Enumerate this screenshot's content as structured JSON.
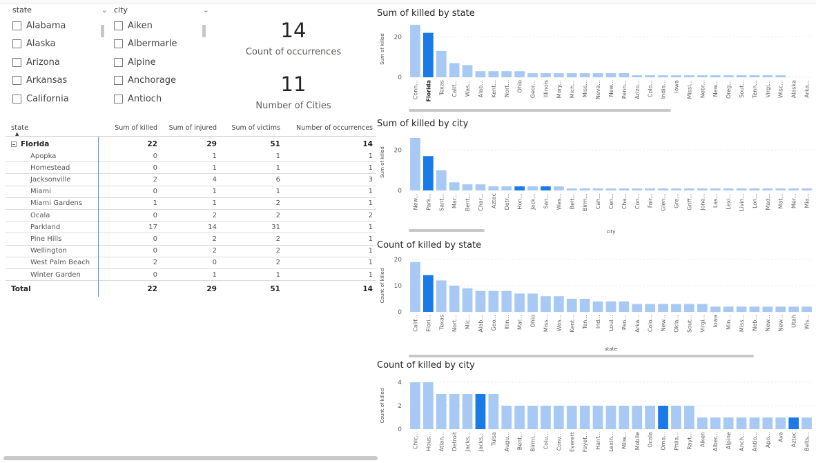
{
  "slicers": {
    "state": {
      "header": "state",
      "items": [
        "Alabama",
        "Alaska",
        "Arizona",
        "Arkansas",
        "California"
      ]
    },
    "city": {
      "header": "city",
      "items": [
        "Aiken",
        "Albermarle",
        "Alpine",
        "Anchorage",
        "Antioch"
      ]
    }
  },
  "cards": {
    "occurrences": {
      "value": "14",
      "label": "Count of occurrences"
    },
    "cities": {
      "value": "11",
      "label": "Number of Cities"
    }
  },
  "matrix": {
    "headers": [
      "state",
      "Sum of killed",
      "Sum of injured",
      "Sum of victims",
      "Number of occurrences"
    ],
    "group": {
      "name": "Florida",
      "killed": "22",
      "injured": "29",
      "victims": "51",
      "occurrences": "14"
    },
    "rows": [
      {
        "city": "Apopka",
        "killed": "0",
        "injured": "1",
        "victims": "1",
        "occurrences": "1"
      },
      {
        "city": "Homestead",
        "killed": "0",
        "injured": "1",
        "victims": "1",
        "occurrences": "1"
      },
      {
        "city": "Jacksonville",
        "killed": "2",
        "injured": "4",
        "victims": "6",
        "occurrences": "3"
      },
      {
        "city": "Miami",
        "killed": "0",
        "injured": "1",
        "victims": "1",
        "occurrences": "1"
      },
      {
        "city": "Miami Gardens",
        "killed": "1",
        "injured": "1",
        "victims": "2",
        "occurrences": "1"
      },
      {
        "city": "Ocala",
        "killed": "0",
        "injured": "2",
        "victims": "2",
        "occurrences": "2"
      },
      {
        "city": "Parkland",
        "killed": "17",
        "injured": "14",
        "victims": "31",
        "occurrences": "1"
      },
      {
        "city": "Pine Hills",
        "killed": "0",
        "injured": "2",
        "victims": "2",
        "occurrences": "1"
      },
      {
        "city": "Wellington",
        "killed": "0",
        "injured": "2",
        "victims": "2",
        "occurrences": "1"
      },
      {
        "city": "West Palm Beach",
        "killed": "2",
        "injured": "0",
        "victims": "2",
        "occurrences": "1"
      },
      {
        "city": "Winter Garden",
        "killed": "0",
        "injured": "1",
        "victims": "1",
        "occurrences": "1"
      }
    ],
    "total": {
      "label": "Total",
      "killed": "22",
      "injured": "29",
      "victims": "51",
      "occurrences": "14"
    }
  },
  "colors": {
    "bar": "#a7c9f3",
    "highlight": "#1a7ae8",
    "grid": "#e8e8e8",
    "text": "#605e5c"
  },
  "chart_data": [
    {
      "type": "bar",
      "title": "Sum of killed by state",
      "ylabel": "Sum of killed",
      "xlabel": "",
      "ylim": [
        0,
        28
      ],
      "yticks": [
        0,
        20
      ],
      "highlight": [
        1
      ],
      "categories": [
        "Conn...",
        "Florida",
        "Texas",
        "Calif...",
        "Was...",
        "Alab...",
        "Kent...",
        "Nort...",
        "Ohio",
        "Geor...",
        "Illinois",
        "Mary...",
        "Mich...",
        "Miss...",
        "Neva...",
        "New...",
        "Penn...",
        "Arizo...",
        "Colo...",
        "India...",
        "Iowa",
        "Missi...",
        "Nebr...",
        "New...",
        "Oreg...",
        "Sout...",
        "Tenn...",
        "Virgi...",
        "Wisc...",
        "Alaska",
        "Arka..."
      ],
      "values": [
        26,
        22,
        13,
        7,
        6,
        3,
        3,
        3,
        3,
        2,
        2,
        2,
        2,
        2,
        2,
        2,
        2,
        1,
        1,
        1,
        1,
        1,
        1,
        1,
        1,
        1,
        1,
        1,
        1,
        0,
        0
      ]
    },
    {
      "type": "bar",
      "title": "Sum of killed by city",
      "ylabel": "Sum of killed",
      "xlabel": "city",
      "ylim": [
        0,
        28
      ],
      "yticks": [
        0,
        20
      ],
      "highlight": [
        1,
        8,
        10,
        31
      ],
      "categories": [
        "New...",
        "Park...",
        "Sant...",
        "Mar...",
        "Bent...",
        "Char...",
        "Aztec",
        "Detr...",
        "Hon...",
        "Jack...",
        "San...",
        "Wes...",
        "Belt...",
        "Birm...",
        "Cah...",
        "Cen...",
        "Cha...",
        "Con...",
        "Fair...",
        "Glen...",
        "Gre...",
        "Griff...",
        "Jone...",
        "Las...",
        "Lexi...",
        "Livin...",
        "Lon...",
        "Mad...",
        "Mat...",
        "Mer...",
        "Mia..."
      ],
      "values": [
        26,
        17,
        10,
        4,
        3,
        3,
        2,
        2,
        2,
        2,
        2,
        2,
        1,
        1,
        1,
        1,
        1,
        1,
        1,
        1,
        1,
        1,
        1,
        1,
        1,
        1,
        1,
        1,
        1,
        1,
        1
      ]
    },
    {
      "type": "bar",
      "title": "Count of killed by state",
      "ylabel": "Count of killed",
      "xlabel": "state",
      "ylim": [
        0,
        20
      ],
      "yticks": [
        0,
        10,
        20
      ],
      "highlight": [
        1
      ],
      "categories": [
        "Calif...",
        "Flori...",
        "Texas",
        "Nort...",
        "Mic...",
        "Alab...",
        "Geo...",
        "Illin...",
        "Mar...",
        "Ohio",
        "Miss...",
        "Was...",
        "Kent...",
        "Ten...",
        "Ind...",
        "Loui...",
        "Pen...",
        "Arka...",
        "Colo...",
        "New...",
        "Okla...",
        "Sout...",
        "Virgi...",
        "Iowa",
        "Min...",
        "Miss...",
        "Neb...",
        "New...",
        "New...",
        "Utah",
        "Wis..."
      ],
      "values": [
        19,
        14,
        12,
        10,
        9,
        8,
        8,
        8,
        7,
        7,
        6,
        6,
        5,
        5,
        4,
        4,
        4,
        3,
        3,
        3,
        3,
        3,
        3,
        2,
        2,
        2,
        2,
        2,
        2,
        2,
        2
      ]
    },
    {
      "type": "bar",
      "title": "Count of killed by city",
      "ylabel": "Count of killed",
      "xlabel": "",
      "ylim": [
        0,
        4
      ],
      "yticks": [
        0,
        2,
        4
      ],
      "highlight": [
        5,
        19,
        29
      ],
      "categories": [
        "Chic...",
        "Hous...",
        "Atlan...",
        "Detroit",
        "Jacks...",
        "Jacks...",
        "Tulsa",
        "Augu...",
        "Bent...",
        "Birmi...",
        "Colu...",
        "Conv...",
        "Everett",
        "Fayet...",
        "Hanf...",
        "Lexin...",
        "Milw...",
        "Mobile",
        "Ocala",
        "Oma...",
        "Phila...",
        "Rayt...",
        "Aiken",
        "Alber...",
        "Alpine",
        "Anch...",
        "Antio...",
        "Apo...",
        "Ava",
        "Aztec",
        "Belts..."
      ],
      "values": [
        4,
        4,
        3,
        3,
        3,
        3,
        3,
        2,
        2,
        2,
        2,
        2,
        2,
        2,
        2,
        2,
        2,
        2,
        2,
        2,
        2,
        2,
        1,
        1,
        1,
        1,
        1,
        1,
        1,
        1,
        1
      ]
    }
  ]
}
